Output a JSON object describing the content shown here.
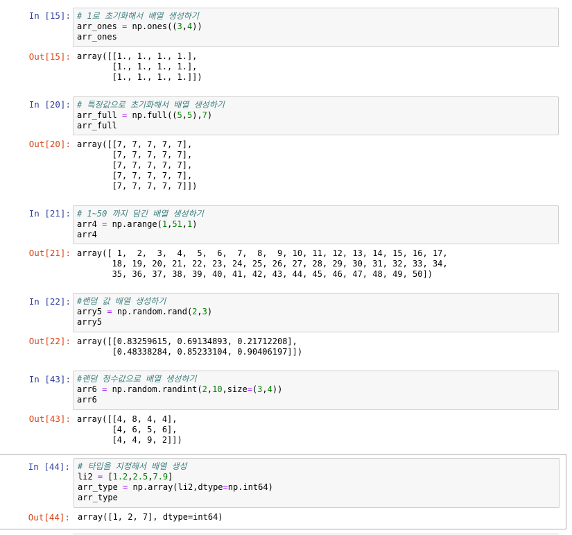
{
  "cells": [
    {
      "in_prompt": "In [15]:",
      "out_prompt": "Out[15]:",
      "code": [
        [
          {
            "t": "# 1로 초기화해서 배열 생성하기",
            "c": "comment"
          }
        ],
        [
          {
            "t": "arr_ones "
          },
          {
            "t": "=",
            "c": "op"
          },
          {
            "t": " np.ones(("
          },
          {
            "t": "3",
            "c": "num"
          },
          {
            "t": ","
          },
          {
            "t": "4",
            "c": "num"
          },
          {
            "t": "))"
          }
        ],
        [
          {
            "t": "arr_ones"
          }
        ]
      ],
      "output": [
        "array([[1., 1., 1., 1.],",
        "       [1., 1., 1., 1.],",
        "       [1., 1., 1., 1.]])"
      ]
    },
    {
      "in_prompt": "In [20]:",
      "out_prompt": "Out[20]:",
      "code": [
        [
          {
            "t": "# 특정값으로 초기화해서 배열 생성하기",
            "c": "comment"
          }
        ],
        [
          {
            "t": "arr_full "
          },
          {
            "t": "=",
            "c": "op"
          },
          {
            "t": " np.full(("
          },
          {
            "t": "5",
            "c": "num"
          },
          {
            "t": ","
          },
          {
            "t": "5",
            "c": "num"
          },
          {
            "t": "),"
          },
          {
            "t": "7",
            "c": "num"
          },
          {
            "t": ")"
          }
        ],
        [
          {
            "t": "arr_full"
          }
        ]
      ],
      "output": [
        "array([[7, 7, 7, 7, 7],",
        "       [7, 7, 7, 7, 7],",
        "       [7, 7, 7, 7, 7],",
        "       [7, 7, 7, 7, 7],",
        "       [7, 7, 7, 7, 7]])"
      ]
    },
    {
      "in_prompt": "In [21]:",
      "out_prompt": "Out[21]:",
      "code": [
        [
          {
            "t": "# 1~50 까지 담긴 배열 생성하기",
            "c": "comment"
          }
        ],
        [
          {
            "t": "arr4 "
          },
          {
            "t": "=",
            "c": "op"
          },
          {
            "t": " np.arange("
          },
          {
            "t": "1",
            "c": "num"
          },
          {
            "t": ","
          },
          {
            "t": "51",
            "c": "num"
          },
          {
            "t": ","
          },
          {
            "t": "1",
            "c": "num"
          },
          {
            "t": ")"
          }
        ],
        [
          {
            "t": "arr4"
          }
        ]
      ],
      "output": [
        "array([ 1,  2,  3,  4,  5,  6,  7,  8,  9, 10, 11, 12, 13, 14, 15, 16, 17,",
        "       18, 19, 20, 21, 22, 23, 24, 25, 26, 27, 28, 29, 30, 31, 32, 33, 34,",
        "       35, 36, 37, 38, 39, 40, 41, 42, 43, 44, 45, 46, 47, 48, 49, 50])"
      ]
    },
    {
      "in_prompt": "In [22]:",
      "out_prompt": "Out[22]:",
      "code": [
        [
          {
            "t": "#랜덤 값 배열 생성하기",
            "c": "comment"
          }
        ],
        [
          {
            "t": "arry5 "
          },
          {
            "t": "=",
            "c": "op"
          },
          {
            "t": " np.random.rand("
          },
          {
            "t": "2",
            "c": "num"
          },
          {
            "t": ","
          },
          {
            "t": "3",
            "c": "num"
          },
          {
            "t": ")"
          }
        ],
        [
          {
            "t": "arry5"
          }
        ]
      ],
      "output": [
        "array([[0.83259615, 0.69134893, 0.21712208],",
        "       [0.48338284, 0.85233104, 0.90406197]])"
      ]
    },
    {
      "in_prompt": "In [43]:",
      "out_prompt": "Out[43]:",
      "code": [
        [
          {
            "t": "#랜덤 정수값으로 배열 생성하기",
            "c": "comment"
          }
        ],
        [
          {
            "t": "arr6 "
          },
          {
            "t": "=",
            "c": "op"
          },
          {
            "t": " np.random.randint("
          },
          {
            "t": "2",
            "c": "num"
          },
          {
            "t": ","
          },
          {
            "t": "10",
            "c": "num"
          },
          {
            "t": ",size"
          },
          {
            "t": "=",
            "c": "op"
          },
          {
            "t": "("
          },
          {
            "t": "3",
            "c": "num"
          },
          {
            "t": ","
          },
          {
            "t": "4",
            "c": "num"
          },
          {
            "t": "))"
          }
        ],
        [
          {
            "t": "arr6"
          }
        ]
      ],
      "output": [
        "array([[4, 8, 4, 4],",
        "       [4, 6, 5, 6],",
        "       [4, 4, 9, 2]])"
      ]
    },
    {
      "in_prompt": "In [44]:",
      "out_prompt": "Out[44]:",
      "code": [
        [
          {
            "t": "# 타입을 지정해서 배열 생성",
            "c": "comment"
          }
        ],
        [
          {
            "t": "li2 "
          },
          {
            "t": "=",
            "c": "op"
          },
          {
            "t": " ["
          },
          {
            "t": "1.2",
            "c": "num"
          },
          {
            "t": ","
          },
          {
            "t": "2.5",
            "c": "num"
          },
          {
            "t": ","
          },
          {
            "t": "7.9",
            "c": "num"
          },
          {
            "t": "]"
          }
        ],
        [
          {
            "t": "arr_type "
          },
          {
            "t": "=",
            "c": "op"
          },
          {
            "t": " np.array(li2,dtype"
          },
          {
            "t": "=",
            "c": "op"
          },
          {
            "t": "np.int64)"
          }
        ],
        [
          {
            "t": "arr_type"
          }
        ]
      ],
      "output": [
        "array([1, 2, 7], dtype=int64)"
      ]
    }
  ]
}
